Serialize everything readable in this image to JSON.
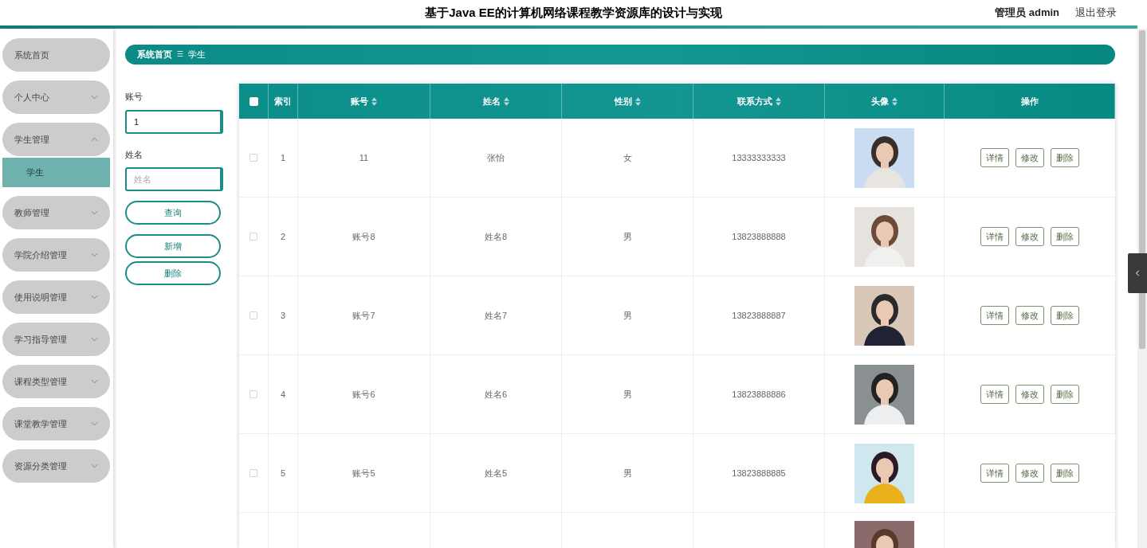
{
  "header": {
    "title": "基于Java EE的计算机网络课程教学资源库的设计与实现",
    "user": "管理员 admin",
    "logout": "退出登录"
  },
  "sidebar": {
    "items": [
      {
        "label": "系统首页"
      },
      {
        "label": "个人中心",
        "expanded": false
      },
      {
        "label": "学生管理",
        "expanded": true,
        "children": [
          {
            "label": "学生",
            "selected": true
          }
        ]
      },
      {
        "label": "教师管理",
        "expanded": false
      },
      {
        "label": "学院介绍管理",
        "expanded": false
      },
      {
        "label": "使用说明管理",
        "expanded": false
      },
      {
        "label": "学习指导管理",
        "expanded": false
      },
      {
        "label": "课程类型管理",
        "expanded": false
      },
      {
        "label": "课堂教学管理",
        "expanded": false
      },
      {
        "label": "资源分类管理",
        "expanded": false
      }
    ]
  },
  "breadcrumb": {
    "items": [
      "系统首页",
      "学生"
    ],
    "separator": "☰"
  },
  "search": {
    "fields": [
      {
        "label": "账号",
        "value": "1"
      },
      {
        "label": "姓名",
        "placeholder": "姓名"
      }
    ],
    "buttons": [
      "查询",
      "新增",
      "删除"
    ]
  },
  "table": {
    "select_all_checked": false,
    "columns": [
      {
        "label": "索引",
        "sortable": false
      },
      {
        "label": "账号",
        "sortable": true
      },
      {
        "label": "姓名",
        "sortable": true
      },
      {
        "label": "性别",
        "sortable": true
      },
      {
        "label": "联系方式",
        "sortable": true
      },
      {
        "label": "头像",
        "sortable": true
      },
      {
        "label": "操作",
        "sortable": false
      }
    ],
    "rows": [
      {
        "checked": false,
        "index": "1",
        "account": "11",
        "name": "张怡",
        "gender": "女",
        "phone": "13333333333",
        "actions": [
          "详情",
          "修改",
          "删除"
        ]
      },
      {
        "checked": false,
        "index": "2",
        "account": "账号8",
        "name": "姓名8",
        "gender": "男",
        "phone": "13823888888",
        "actions": [
          "详情",
          "修改",
          "删除"
        ]
      },
      {
        "checked": false,
        "index": "3",
        "account": "账号7",
        "name": "姓名7",
        "gender": "男",
        "phone": "13823888887",
        "actions": [
          "详情",
          "修改",
          "删除"
        ]
      },
      {
        "checked": false,
        "index": "4",
        "account": "账号6",
        "name": "姓名6",
        "gender": "男",
        "phone": "13823888886",
        "actions": [
          "详情",
          "修改",
          "删除"
        ]
      },
      {
        "checked": false,
        "index": "5",
        "account": "账号5",
        "name": "姓名5",
        "gender": "男",
        "phone": "13823888885",
        "actions": [
          "详情",
          "修改",
          "删除"
        ]
      }
    ]
  }
}
